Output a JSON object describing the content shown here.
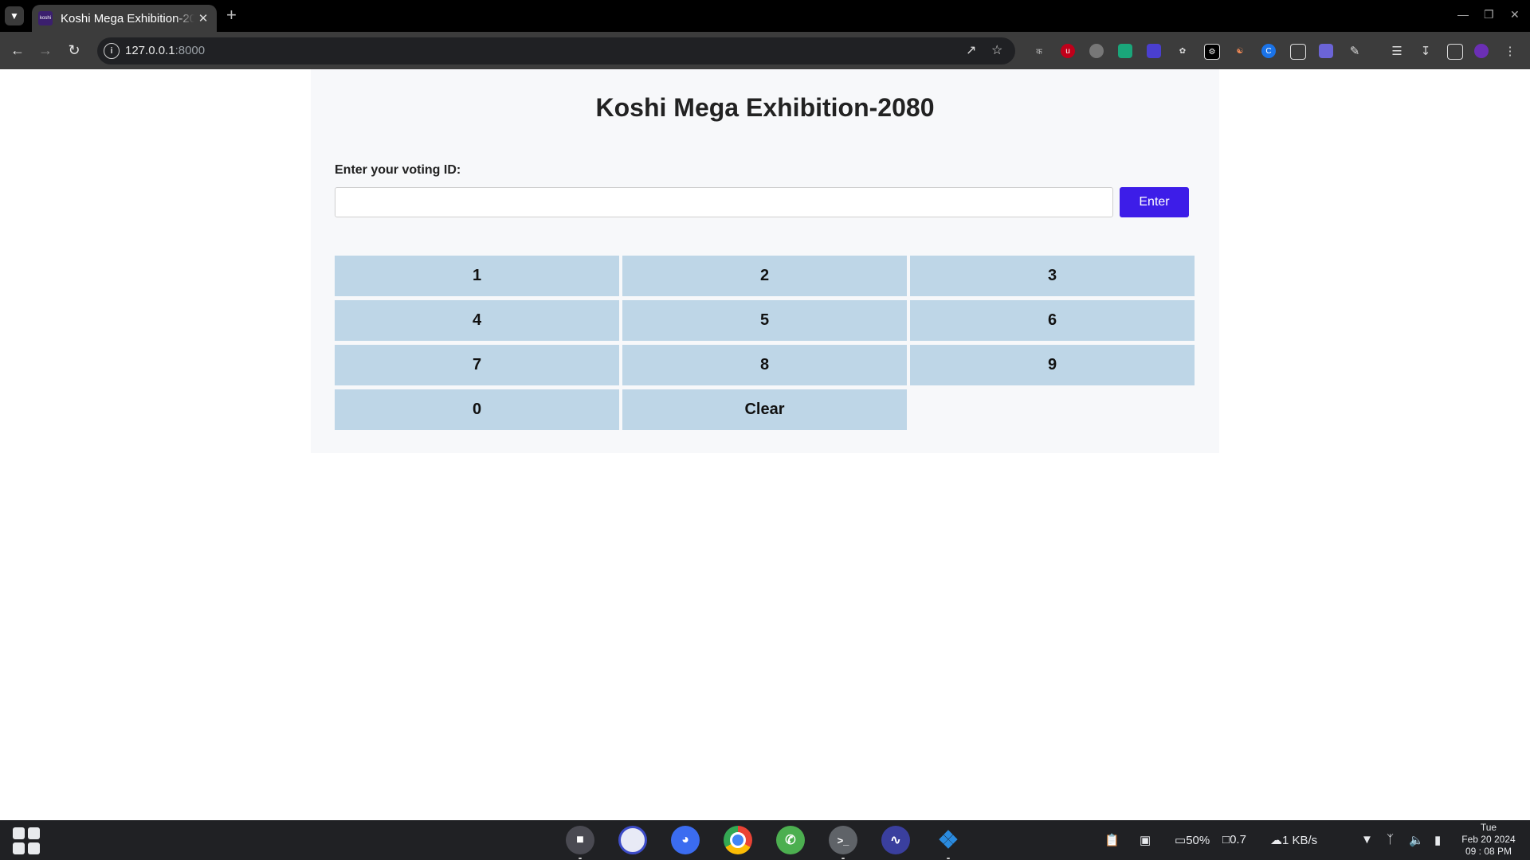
{
  "browser": {
    "tab_title": "Koshi Mega Exhibition-2080",
    "favicon_text": "koshi",
    "new_tab": "+",
    "url_host": "127.0.0.1",
    "url_port": ":8000"
  },
  "page": {
    "title": "Koshi Mega Exhibition-2080",
    "voting_label": "Enter your voting ID:",
    "voting_input_value": "",
    "enter_label": "Enter",
    "keys": [
      "1",
      "2",
      "3",
      "4",
      "5",
      "6",
      "7",
      "8",
      "9",
      "0",
      "Clear"
    ],
    "accent_color": "#3d1de8",
    "key_color": "#bed6e7"
  },
  "taskbar": {
    "battery": "50%",
    "cpu_load": "0.7",
    "network": "1 KB/s",
    "day": "Tue",
    "date": "Feb 20 2024",
    "time": "09 : 08 PM"
  }
}
